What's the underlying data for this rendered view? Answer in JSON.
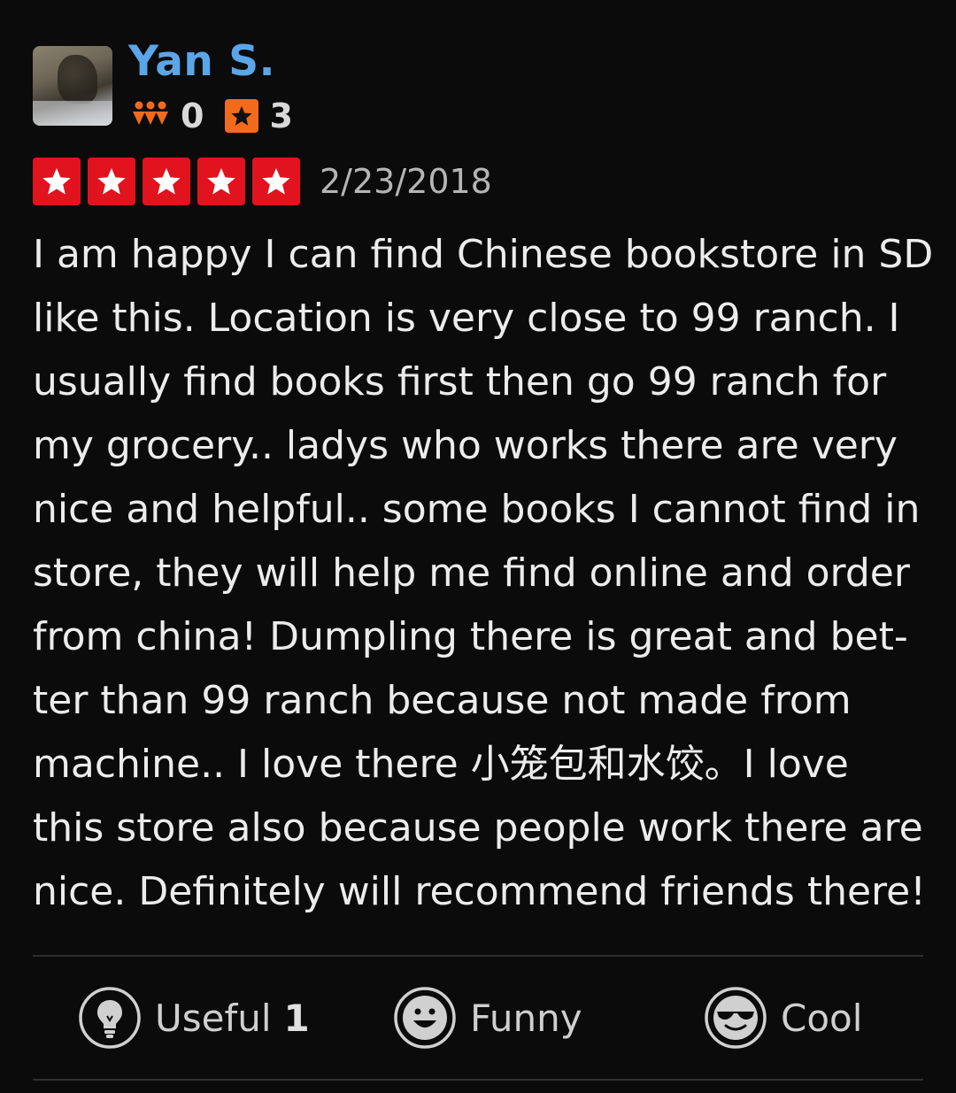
{
  "user": {
    "name": "Yan S.",
    "friends_count": "0",
    "reviews_count": "3"
  },
  "review": {
    "rating": 5,
    "rating_max": 5,
    "date": "2/23/2018",
    "text_lines": [
      "I am happy I can find Chinese bookstore in SD",
      "like this. Location is very close to 99 ranch. I",
      "usually find books first then go 99 ranch for",
      "my grocery.. ladys who works there are very",
      "nice and helpful.. some books I cannot find in",
      "store, they will help me find online and order",
      "from china! Dumpling there is great and bet-",
      "ter than 99 ranch because not made from",
      "machine.. I love there 小笼包和水饺。I love",
      "this store also because people work there are",
      "nice. Definitely will recommend friends there!"
    ]
  },
  "reactions": {
    "useful": {
      "label": "Useful",
      "count": "1"
    },
    "funny": {
      "label": "Funny"
    },
    "cool": {
      "label": "Cool"
    }
  },
  "colors": {
    "background": "#0b0b0b",
    "username": "#5aa6e8",
    "star_red": "#e0131f",
    "friends_orange": "#f26a1b",
    "reviews_orange": "#f26a1b"
  },
  "icons": {
    "friends": "friends-icon",
    "reviews": "review-star-icon",
    "useful": "lightbulb-icon",
    "funny": "smiley-icon",
    "cool": "sunglasses-icon"
  }
}
